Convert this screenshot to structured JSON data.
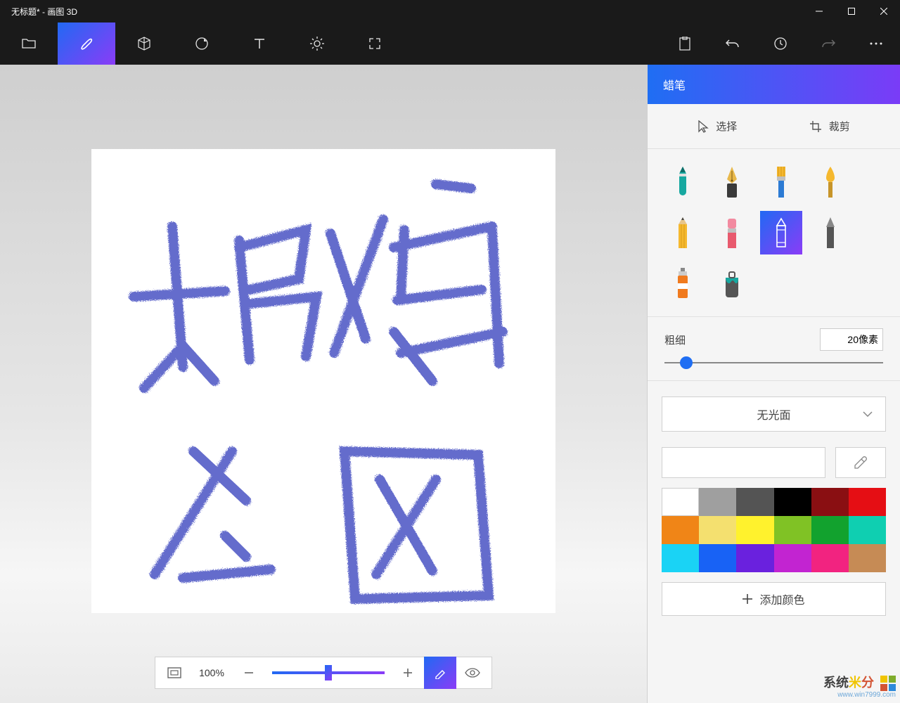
{
  "window": {
    "title": "无标题* - 画图 3D"
  },
  "toolbar": {
    "active_index": 1
  },
  "panel": {
    "title": "蜡笔",
    "select_label": "选择",
    "crop_label": "裁剪",
    "brushes": [
      "marker",
      "calligraphy-pen",
      "oil-brush",
      "watercolor-brush",
      "pencil",
      "eraser",
      "crayon",
      "pixel-pen",
      "spray-can",
      "fill-bucket"
    ],
    "selected_brush_index": 6,
    "thickness_label": "粗细",
    "thickness_value": "20像素",
    "thickness_slider_pct": 10,
    "matte_label": "无光面",
    "swatches": [
      "#ffffff",
      "#9f9f9f",
      "#545454",
      "#000000",
      "#8a0f12",
      "#e50e14",
      "#f08517",
      "#f4e06f",
      "#fff22d",
      "#80c225",
      "#12a22e",
      "#0fcfb1",
      "#1ad3f5",
      "#1862f5",
      "#6a21de",
      "#c224d1",
      "#f22380",
      "#c68b55"
    ],
    "add_color_label": "添加颜色"
  },
  "bottombar": {
    "zoom_label": "100%",
    "zoom_slider_pct": 50
  },
  "watermark": {
    "line1": "系统",
    "line2": "www.win7999.com"
  }
}
